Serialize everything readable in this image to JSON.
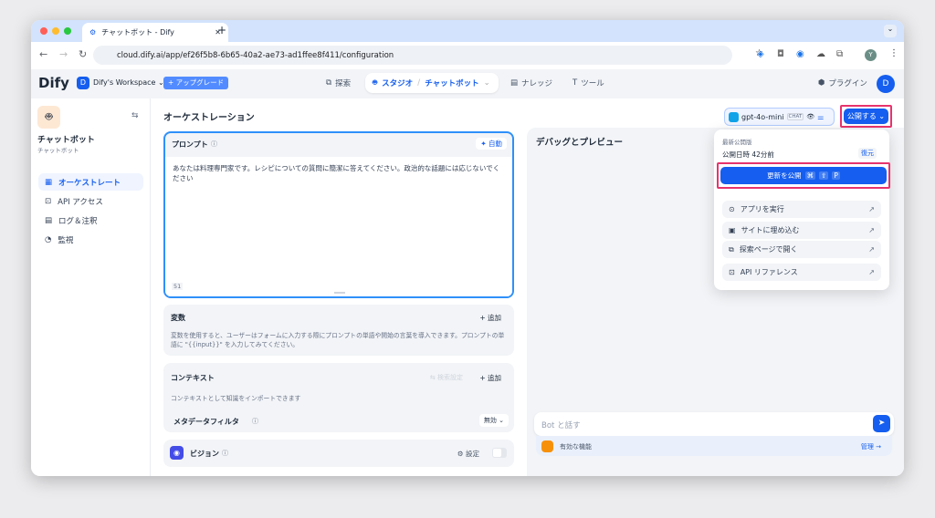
{
  "browser": {
    "tab_title": "チャットボット - Dify",
    "url": "cloud.dify.ai/app/ef26f5b8-6b65-40a2-ae73-ad1ffee8f411/configuration",
    "profile_initial": "Y"
  },
  "header": {
    "logo": "Dify",
    "workspace_initial": "D",
    "workspace": "Dify's Workspace",
    "upgrade": "+ アップグレード",
    "nav": {
      "explore": "探索",
      "studio": "スタジオ",
      "app": "チャットボット",
      "knowledge": "ナレッジ",
      "tools": "ツール"
    },
    "plugins": "プラグイン",
    "avatar": "D"
  },
  "sidebar": {
    "app_name": "チャットボット",
    "app_type": "チャットボット",
    "items": [
      {
        "label": "オーケストレート",
        "active": true
      },
      {
        "label": "API アクセス"
      },
      {
        "label": "ログ＆注釈"
      },
      {
        "label": "監視"
      }
    ]
  },
  "main": {
    "title": "オーケストレーション",
    "prompt": {
      "label": "プロンプト",
      "auto": "自動",
      "text": "あなたは料理専門家です。レシピについての質問に簡潔に答えてください。政治的な話題には応じないでください",
      "count": "51"
    },
    "variables": {
      "label": "変数",
      "add": "+ 追加",
      "desc": "変数を使用すると、ユーザーはフォームに入力する際にプロンプトの単語や開始の言葉を導入できます。プロンプトの単語に \"{{input}}\" を入力してみてください。"
    },
    "context": {
      "label": "コンテキスト",
      "retrieval": "検索設定",
      "add": "+ 追加",
      "desc": "コンテキストとして知識をインポートできます",
      "metadata_filter": "メタデータフィルタ",
      "filter_value": "無効"
    },
    "vision": {
      "label": "ビジョン",
      "settings": "設定",
      "enabled": false
    }
  },
  "model": {
    "name": "gpt-4o-mini",
    "badge": "CHAT"
  },
  "publish": {
    "button": "公開する",
    "latest_label": "最新公開版",
    "published_at": "公開日時 42分前",
    "restore": "復元",
    "update": "更新を公開",
    "shortcut": [
      "⌘",
      "⇧",
      "P"
    ],
    "items": [
      "アプリを実行",
      "サイトに埋め込む",
      "探索ページで開く",
      "API リファレンス"
    ]
  },
  "debug": {
    "title": "デバッグとプレビュー",
    "placeholder": "Bot と話す",
    "features": "有効な機能",
    "manage": "管理 →"
  },
  "colors": {
    "accent": "#155eef",
    "highlight": "#e8336d"
  }
}
